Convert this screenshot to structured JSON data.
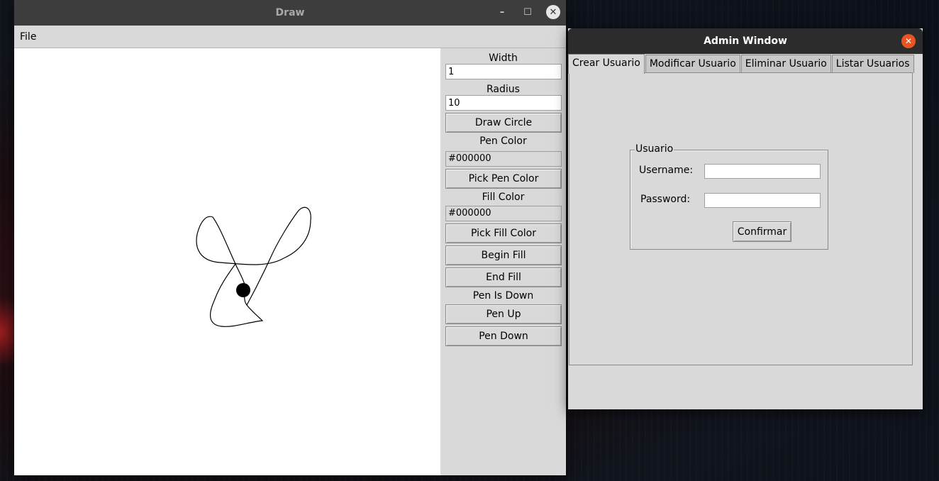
{
  "draw_window": {
    "title": "Draw",
    "controls": {
      "minimize": "–",
      "maximize": "☐",
      "close": "✕"
    },
    "menu": {
      "file": "File"
    },
    "panel": {
      "width_label": "Width",
      "width_value": "1",
      "radius_label": "Radius",
      "radius_value": "10",
      "draw_circle_button": "Draw Circle",
      "pen_color_label": "Pen Color",
      "pen_color_value": "#000000",
      "pick_pen_color_button": "Pick Pen Color",
      "fill_color_label": "Fill Color",
      "fill_color_value": "#000000",
      "pick_fill_color_button": "Pick Fill Color",
      "begin_fill_button": "Begin Fill",
      "end_fill_button": "End Fill",
      "pen_status": "Pen Is Down",
      "pen_up_button": "Pen Up",
      "pen_down_button": "Pen Down"
    }
  },
  "admin_window": {
    "title": "Admin Window",
    "close": "✕",
    "tabs": [
      {
        "label": "Crear Usuario"
      },
      {
        "label": "Modificar Usuario"
      },
      {
        "label": "Eliminar Usuario"
      },
      {
        "label": "Listar Usuarios"
      }
    ],
    "active_tab": "Crear Usuario",
    "form": {
      "legend": "Usuario",
      "username_label": "Username:",
      "username_value": "",
      "password_label": "Password:",
      "password_value": "",
      "confirm_button": "Confirmar"
    }
  },
  "colors": {
    "draw_titlebar": "#3d3d3d",
    "admin_titlebar": "#2c2c2c",
    "admin_close": "#e95420",
    "panel_bg": "#d9d9d9",
    "pen": "#000000"
  }
}
